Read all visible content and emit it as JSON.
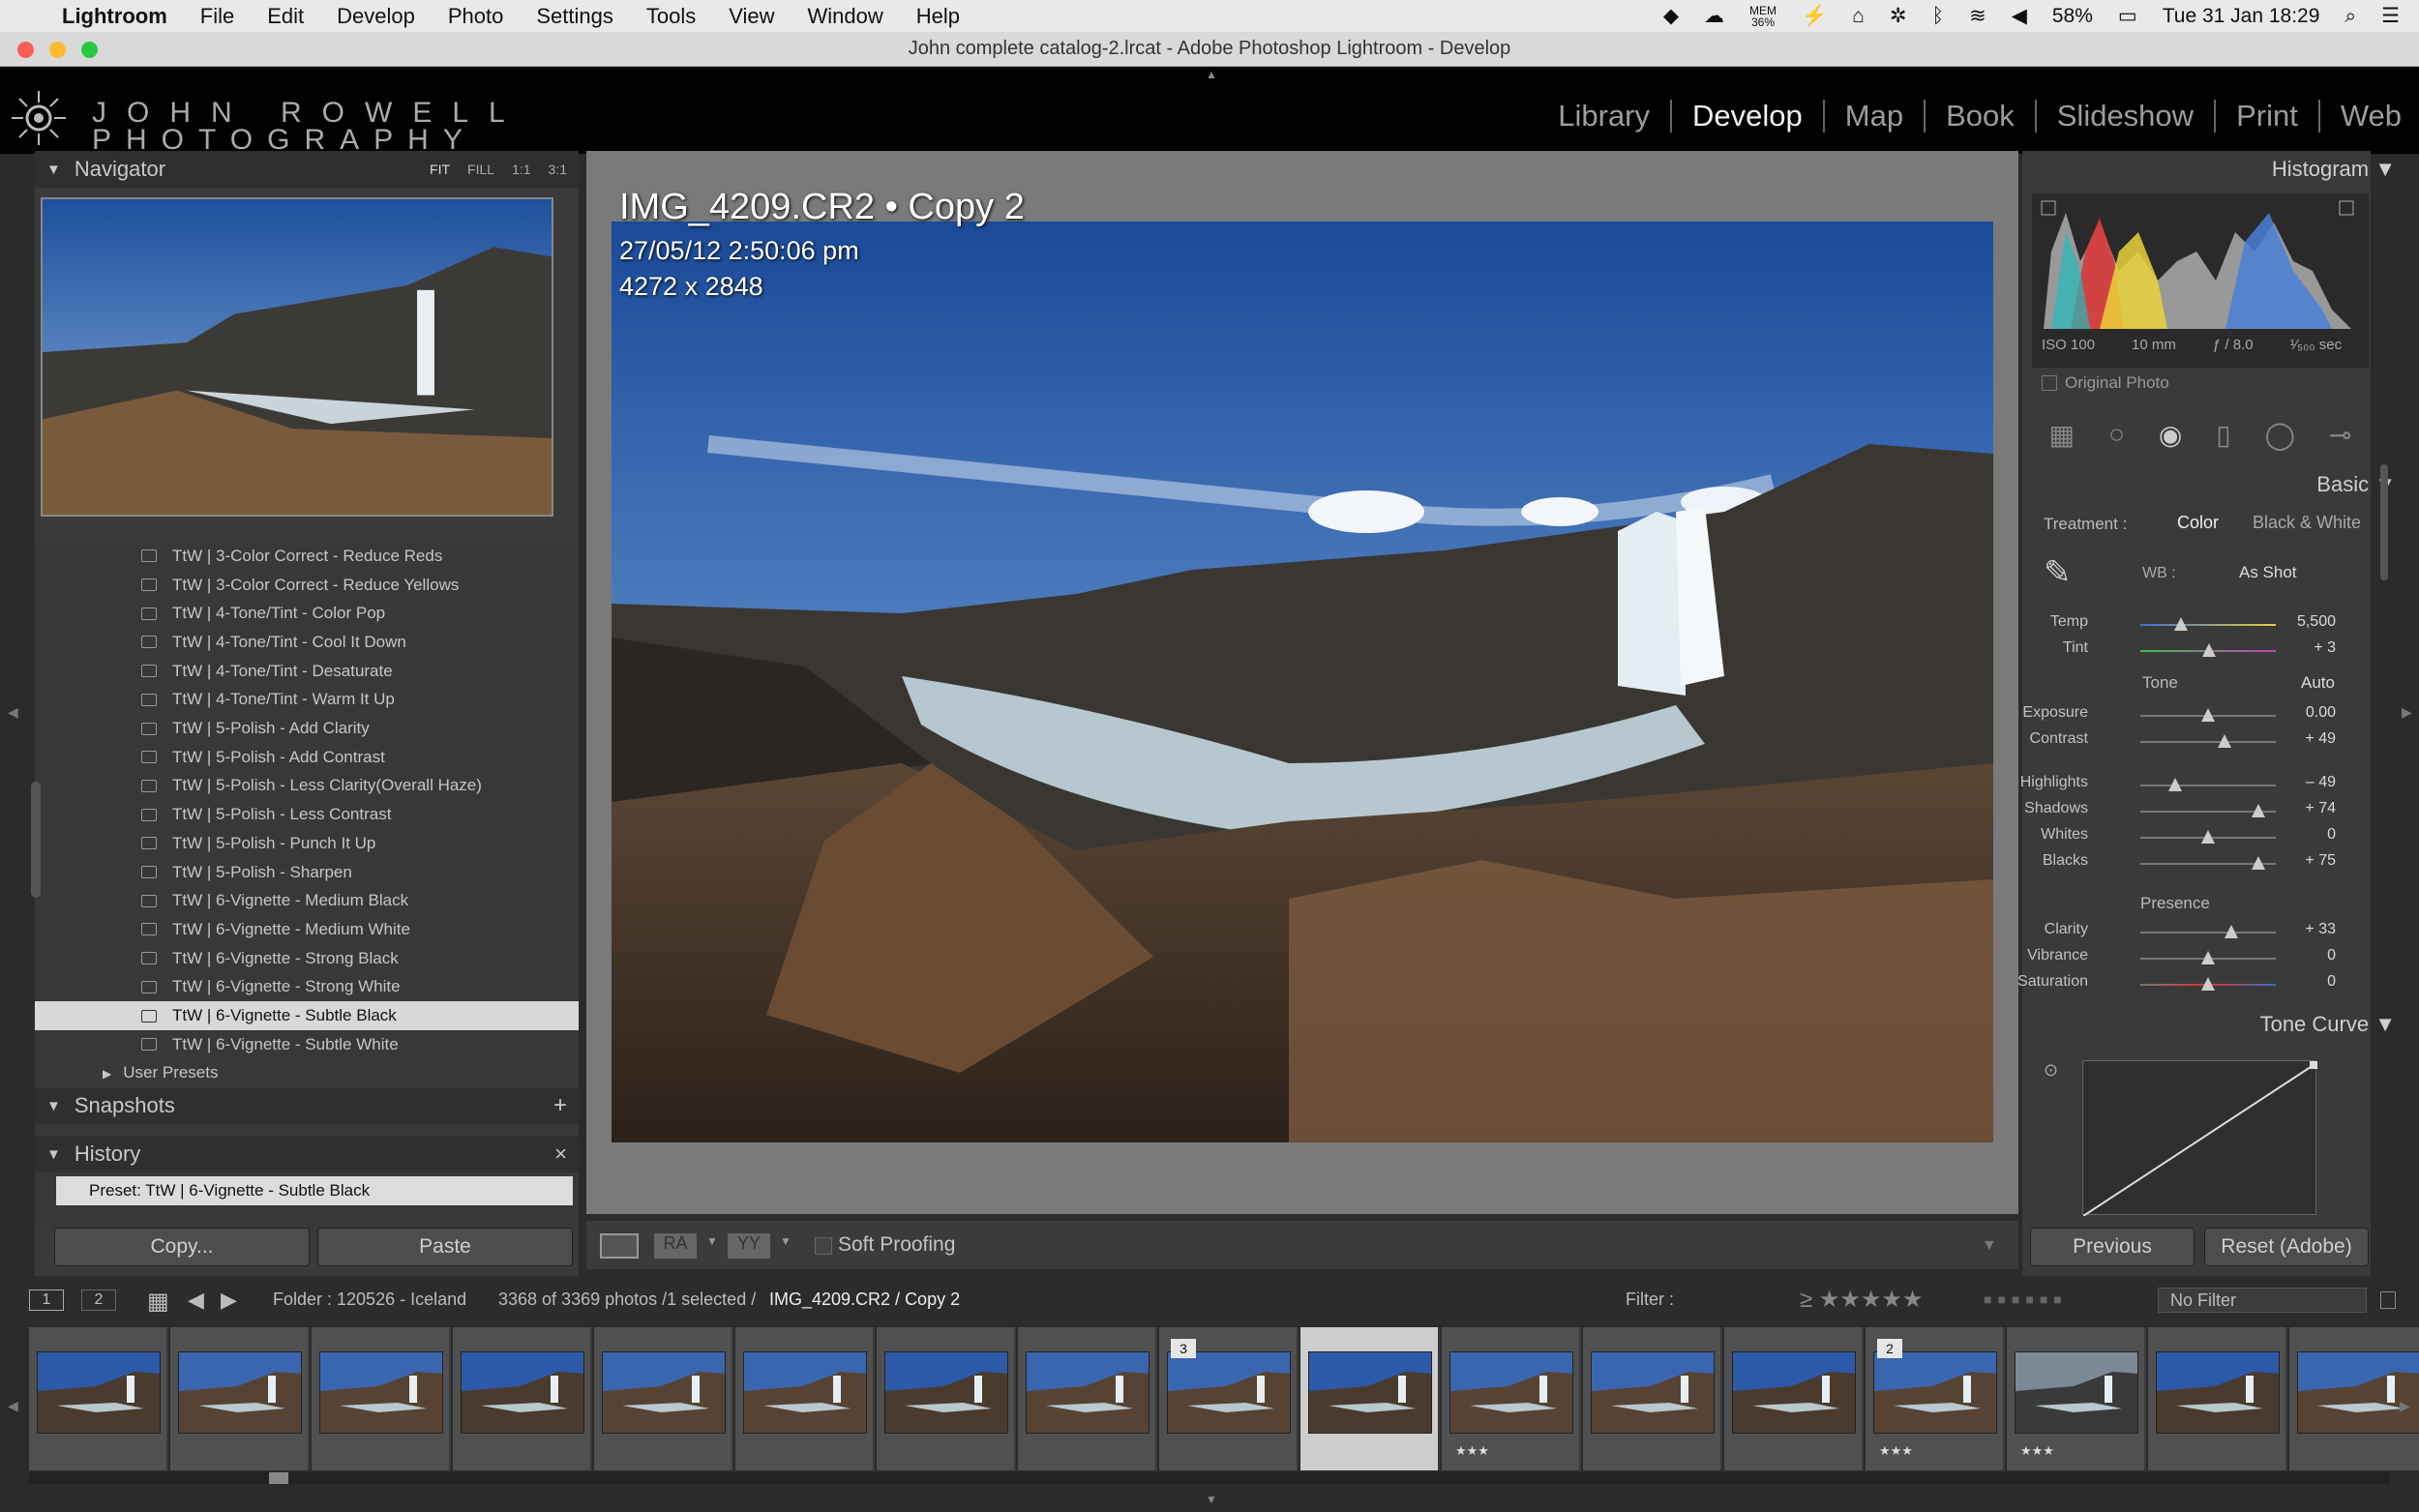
{
  "menubar": {
    "app": "Lightroom",
    "items": [
      "File",
      "Edit",
      "Develop",
      "Photo",
      "Settings",
      "Tools",
      "View",
      "Window",
      "Help"
    ],
    "battery_pct_cpu": "36%",
    "mem_label": "MEM",
    "battery": "58%",
    "datetime": "Tue 31 Jan  18:29"
  },
  "window": {
    "title": "John complete catalog-2.lrcat - Adobe Photoshop Lightroom - Develop"
  },
  "identity": {
    "line1": "JOHN ROWELL",
    "line2": "PHOTOGRAPHY"
  },
  "modules": [
    "Library",
    "Develop",
    "Map",
    "Book",
    "Slideshow",
    "Print",
    "Web"
  ],
  "active_module": "Develop",
  "navigator": {
    "title": "Navigator",
    "zoom": [
      "FIT",
      "FILL",
      "1:1",
      "3:1"
    ]
  },
  "presets": [
    "TtW | 3-Color Correct - Reduce Reds",
    "TtW | 3-Color Correct - Reduce Yellows",
    "TtW | 4-Tone/Tint - Color Pop",
    "TtW | 4-Tone/Tint - Cool It Down",
    "TtW | 4-Tone/Tint - Desaturate",
    "TtW | 4-Tone/Tint - Warm It Up",
    "TtW | 5-Polish - Add Clarity",
    "TtW | 5-Polish - Add Contrast",
    "TtW | 5-Polish - Less Clarity(Overall Haze)",
    "TtW | 5-Polish - Less Contrast",
    "TtW | 5-Polish - Punch It Up",
    "TtW | 5-Polish - Sharpen",
    "TtW | 6-Vignette - Medium Black",
    "TtW | 6-Vignette - Medium White",
    "TtW | 6-Vignette - Strong Black",
    "TtW | 6-Vignette - Strong White",
    "TtW | 6-Vignette - Subtle Black",
    "TtW | 6-Vignette - Subtle White"
  ],
  "selected_preset_index": 16,
  "user_presets": "User Presets",
  "snapshots": {
    "title": "Snapshots",
    "add": "+"
  },
  "history": {
    "title": "History",
    "clear": "×",
    "item": "Preset: TtW | 6-Vignette - Subtle Black"
  },
  "buttons": {
    "copy": "Copy...",
    "paste": "Paste",
    "previous": "Previous",
    "reset": "Reset (Adobe)"
  },
  "image_info": {
    "name": "IMG_4209.CR2  •  Copy 2",
    "date": "27/05/12 2:50:06 pm",
    "dims": "4272 x 2848"
  },
  "toolbar": {
    "soft_proofing": "Soft Proofing"
  },
  "histogram": {
    "title": "Histogram",
    "iso": "ISO 100",
    "focal": "10 mm",
    "aperture": "ƒ / 8.0",
    "shutter": "¹⁄₅₀₀ sec",
    "original": "Original Photo"
  },
  "basic": {
    "title": "Basic",
    "treatment_label": "Treatment :",
    "color": "Color",
    "bw": "Black & White",
    "wb_label": "WB :",
    "wb_value": "As Shot",
    "tone": "Tone",
    "auto": "Auto",
    "presence": "Presence",
    "sliders": [
      {
        "label": "Temp",
        "value": "5,500",
        "pos": 0.3
      },
      {
        "label": "Tint",
        "value": "+ 3",
        "pos": 0.51
      },
      {
        "label": "Exposure",
        "value": "0.00",
        "pos": 0.5
      },
      {
        "label": "Contrast",
        "value": "+ 49",
        "pos": 0.62
      },
      {
        "label": "Highlights",
        "value": "– 49",
        "pos": 0.26
      },
      {
        "label": "Shadows",
        "value": "+ 74",
        "pos": 0.87
      },
      {
        "label": "Whites",
        "value": "0",
        "pos": 0.5
      },
      {
        "label": "Blacks",
        "value": "+ 75",
        "pos": 0.87
      },
      {
        "label": "Clarity",
        "value": "+ 33",
        "pos": 0.67
      },
      {
        "label": "Vibrance",
        "value": "0",
        "pos": 0.5
      },
      {
        "label": "Saturation",
        "value": "0",
        "pos": 0.5
      }
    ]
  },
  "tone_curve": {
    "title": "Tone Curve"
  },
  "filmbar": {
    "pages": [
      "1",
      "2"
    ],
    "folder": "Folder : 120526 - Iceland",
    "count": "3368 of 3369 photos /1 selected /",
    "file": "IMG_4209.CR2 / Copy 2",
    "filter_label": "Filter :",
    "filter_value": "No Filter"
  },
  "film_cells": [
    {
      "stars": "",
      "badge": ""
    },
    {
      "stars": "",
      "badge": ""
    },
    {
      "stars": "",
      "badge": ""
    },
    {
      "stars": "",
      "badge": ""
    },
    {
      "stars": "",
      "badge": ""
    },
    {
      "stars": "",
      "badge": ""
    },
    {
      "stars": "",
      "badge": ""
    },
    {
      "stars": "",
      "badge": ""
    },
    {
      "stars": "",
      "badge": "3"
    },
    {
      "stars": "",
      "badge": ""
    },
    {
      "stars": "★★★",
      "badge": ""
    },
    {
      "stars": "",
      "badge": ""
    },
    {
      "stars": "",
      "badge": ""
    },
    {
      "stars": "★★★",
      "badge": "2"
    },
    {
      "stars": "★★★",
      "badge": ""
    },
    {
      "stars": "",
      "badge": ""
    },
    {
      "stars": "",
      "badge": ""
    }
  ],
  "selected_film_index": 9,
  "colors": {
    "accent": "#f2f2f2",
    "panel": "#3a3a3a",
    "center": "#7a7a7a"
  }
}
